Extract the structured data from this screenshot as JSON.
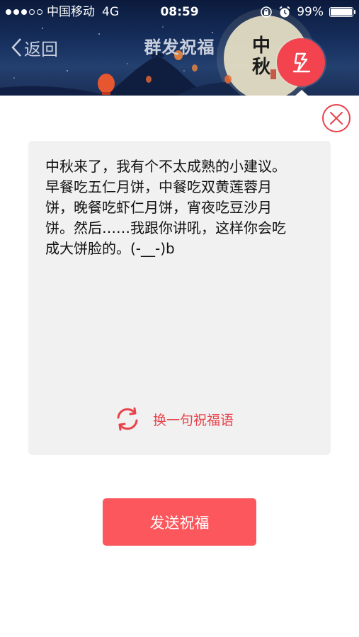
{
  "status_bar": {
    "carrier": "中国移动",
    "network": "4G",
    "time": "08:59",
    "battery": "99%",
    "battery_level": 0.99,
    "signal_bars_filled": 3,
    "signal_bars_total": 5,
    "icons": [
      "lock-rotation-icon",
      "alarm-icon",
      "battery-icon"
    ]
  },
  "header": {
    "back_label": "返回",
    "title": "群发祝福",
    "banner_text": "中秋",
    "edit_icon": "edit-pen-icon",
    "colors": {
      "accent": "#f2434e"
    }
  },
  "close_icon": "close-circle-icon",
  "card": {
    "message": "中秋来了，我有个不太成熟的小建议。早餐吃五仁月饼，中餐吃双黄莲蓉月饼，晚餐吃虾仁月饼，宵夜吃豆沙月饼。然后……我跟你讲吼，这样你会吃成大饼脸的。(-__-)b",
    "swap_label": "换一句祝福语",
    "swap_icon": "refresh-icon"
  },
  "send_button": {
    "label": "发送祝福",
    "color": "#fb575c"
  }
}
